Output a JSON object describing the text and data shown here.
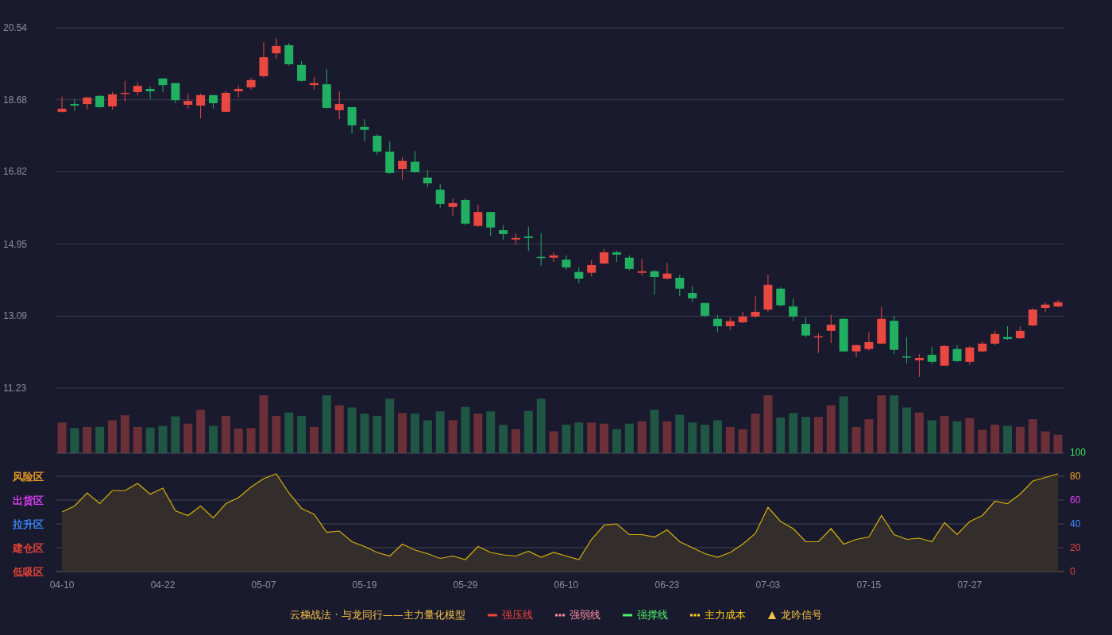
{
  "price_chart": {
    "chart_data": {
      "type": "candlestick",
      "grid": true,
      "ylim": [
        11.23,
        20.54
      ],
      "yticks": [
        20.54,
        18.68,
        16.82,
        14.95,
        13.09,
        11.23
      ],
      "categories": [
        null,
        null,
        null,
        null,
        null,
        null,
        null,
        null,
        null,
        null,
        null,
        null,
        null,
        null,
        null,
        null,
        null,
        null,
        null,
        null,
        null,
        null,
        null,
        null,
        null,
        null,
        null,
        null,
        null,
        null,
        null,
        null,
        null,
        null,
        null,
        null,
        null,
        null,
        null,
        null,
        null,
        null,
        null,
        null,
        null,
        null,
        null,
        null,
        null,
        null,
        null,
        null,
        null,
        null,
        null,
        null,
        null,
        null,
        null,
        null,
        null,
        null,
        null,
        null,
        null,
        null,
        null,
        null,
        null,
        null,
        null,
        null,
        null,
        null,
        null,
        null,
        null,
        null,
        null,
        null
      ],
      "ohlc": [
        [
          18.37,
          18.76,
          18.35,
          18.45
        ],
        [
          18.57,
          18.7,
          18.39,
          18.53
        ],
        [
          18.57,
          18.76,
          18.43,
          18.74
        ],
        [
          18.78,
          18.8,
          18.47,
          18.49
        ],
        [
          18.51,
          18.88,
          18.43,
          18.82
        ],
        [
          18.84,
          19.17,
          18.63,
          18.86
        ],
        [
          18.88,
          19.13,
          18.8,
          19.04
        ],
        [
          18.96,
          19.02,
          18.7,
          18.9
        ],
        [
          19.23,
          19.23,
          18.88,
          19.06
        ],
        [
          19.11,
          19.11,
          18.59,
          18.67
        ],
        [
          18.55,
          18.84,
          18.45,
          18.65
        ],
        [
          18.53,
          18.84,
          18.2,
          18.8
        ],
        [
          18.8,
          18.8,
          18.45,
          18.59
        ],
        [
          18.37,
          18.9,
          18.37,
          18.86
        ],
        [
          18.9,
          19.04,
          18.74,
          18.96
        ],
        [
          19.0,
          19.25,
          18.94,
          19.19
        ],
        [
          19.29,
          20.17,
          19.25,
          19.78
        ],
        [
          19.88,
          20.27,
          19.74,
          20.07
        ],
        [
          20.09,
          20.15,
          19.56,
          19.6
        ],
        [
          19.58,
          19.68,
          19.15,
          19.17
        ],
        [
          19.06,
          19.27,
          18.94,
          19.11
        ],
        [
          19.08,
          19.47,
          18.45,
          18.47
        ],
        [
          18.41,
          18.9,
          18.18,
          18.57
        ],
        [
          18.49,
          18.49,
          17.81,
          18.02
        ],
        [
          17.98,
          18.18,
          17.61,
          17.9
        ],
        [
          17.75,
          17.79,
          17.26,
          17.34
        ],
        [
          17.34,
          17.61,
          16.77,
          16.79
        ],
        [
          16.89,
          17.2,
          16.62,
          17.1
        ],
        [
          17.08,
          17.36,
          16.79,
          16.81
        ],
        [
          16.67,
          16.87,
          16.42,
          16.52
        ],
        [
          16.36,
          16.5,
          15.89,
          15.99
        ],
        [
          15.91,
          16.13,
          15.68,
          16.01
        ],
        [
          16.09,
          16.13,
          15.44,
          15.48
        ],
        [
          15.42,
          15.97,
          15.4,
          15.78
        ],
        [
          15.78,
          15.78,
          15.17,
          15.38
        ],
        [
          15.31,
          15.44,
          15.07,
          15.21
        ],
        [
          15.07,
          15.23,
          14.94,
          15.11
        ],
        [
          15.15,
          15.4,
          14.78,
          15.11
        ],
        [
          14.62,
          15.23,
          14.39,
          14.6
        ],
        [
          14.6,
          14.74,
          14.49,
          14.66
        ],
        [
          14.55,
          14.66,
          14.29,
          14.35
        ],
        [
          14.23,
          14.35,
          13.94,
          14.06
        ],
        [
          14.21,
          14.53,
          14.12,
          14.41
        ],
        [
          14.45,
          14.82,
          14.43,
          14.74
        ],
        [
          14.74,
          14.78,
          14.49,
          14.68
        ],
        [
          14.6,
          14.66,
          14.27,
          14.31
        ],
        [
          14.21,
          14.57,
          14.14,
          14.25
        ],
        [
          14.25,
          14.29,
          13.65,
          14.1
        ],
        [
          14.06,
          14.47,
          14.04,
          14.19
        ],
        [
          14.08,
          14.16,
          13.61,
          13.8
        ],
        [
          13.69,
          13.86,
          13.45,
          13.55
        ],
        [
          13.43,
          13.43,
          13.06,
          13.1
        ],
        [
          13.02,
          13.12,
          12.67,
          12.83
        ],
        [
          12.83,
          13.06,
          12.73,
          12.96
        ],
        [
          12.93,
          13.2,
          12.91,
          13.08
        ],
        [
          13.08,
          13.61,
          13.04,
          13.2
        ],
        [
          13.26,
          14.16,
          13.2,
          13.9
        ],
        [
          13.8,
          13.84,
          13.34,
          13.37
        ],
        [
          13.34,
          13.55,
          12.97,
          13.08
        ],
        [
          12.89,
          13.06,
          12.55,
          12.59
        ],
        [
          12.55,
          12.65,
          12.14,
          12.57
        ],
        [
          12.71,
          13.12,
          12.4,
          12.87
        ],
        [
          13.02,
          13.04,
          12.16,
          12.18
        ],
        [
          12.18,
          12.36,
          12.03,
          12.34
        ],
        [
          12.24,
          12.67,
          12.2,
          12.42
        ],
        [
          12.38,
          13.34,
          12.36,
          13.02
        ],
        [
          12.97,
          13.1,
          12.11,
          12.22
        ],
        [
          12.05,
          12.55,
          11.87,
          12.03
        ],
        [
          11.95,
          12.11,
          11.52,
          12.01
        ],
        [
          12.09,
          12.3,
          11.85,
          11.91
        ],
        [
          11.81,
          12.34,
          11.81,
          12.32
        ],
        [
          12.24,
          12.34,
          11.91,
          11.93
        ],
        [
          11.91,
          12.32,
          11.83,
          12.28
        ],
        [
          12.18,
          12.44,
          12.16,
          12.38
        ],
        [
          12.38,
          12.71,
          12.34,
          12.63
        ],
        [
          12.55,
          12.83,
          12.48,
          12.5
        ],
        [
          12.52,
          12.83,
          12.5,
          12.71
        ],
        [
          12.85,
          13.3,
          12.83,
          13.26
        ],
        [
          13.3,
          13.45,
          13.2,
          13.39
        ],
        [
          13.34,
          13.51,
          13.32,
          13.45
        ]
      ]
    }
  },
  "indicator_chart": {
    "zones": [
      {
        "label": "风险区",
        "color": "#f5a623"
      },
      {
        "label": "出货区",
        "color": "#e040fb"
      },
      {
        "label": "拉升区",
        "color": "#3d8bfd"
      },
      {
        "label": "建仓区",
        "color": "#f0453a"
      },
      {
        "label": "低吸区",
        "color": "#f0453a"
      }
    ],
    "chart_data": {
      "type": "area",
      "grid": true,
      "ylim": [
        0,
        100
      ],
      "yticks": [
        100,
        80,
        60,
        40,
        20,
        0
      ],
      "categories": [
        "04-10",
        null,
        null,
        null,
        null,
        null,
        null,
        null,
        "04-22",
        null,
        null,
        null,
        null,
        null,
        null,
        null,
        "05-07",
        null,
        null,
        null,
        null,
        null,
        null,
        null,
        "05-19",
        null,
        null,
        null,
        null,
        null,
        null,
        null,
        "05-29",
        null,
        null,
        null,
        null,
        null,
        null,
        null,
        "06-10",
        null,
        null,
        null,
        null,
        null,
        null,
        null,
        "06-23",
        null,
        null,
        null,
        null,
        null,
        null,
        null,
        "07-03",
        null,
        null,
        null,
        null,
        null,
        null,
        null,
        "07-15",
        null,
        null,
        null,
        null,
        null,
        null,
        null,
        "07-27",
        null,
        null,
        null,
        null,
        null,
        null,
        null
      ],
      "series": [
        {
          "color": "#d4b20a",
          "values": [
            50,
            55,
            66,
            57,
            68,
            68,
            74,
            65,
            70,
            51,
            47,
            55,
            45,
            57,
            62,
            71,
            78,
            82,
            66,
            53,
            48,
            33,
            34,
            25,
            21,
            16,
            13,
            23,
            18,
            15,
            11,
            13,
            10,
            21,
            16,
            14,
            13,
            17,
            12,
            16,
            13,
            10,
            27,
            39,
            40,
            31,
            31,
            29,
            35,
            25,
            20,
            15,
            12,
            16,
            23,
            32,
            54,
            42,
            36,
            25,
            25,
            36,
            23,
            27,
            29,
            47,
            31,
            27,
            28,
            25,
            41,
            31,
            42,
            47,
            59,
            57,
            65,
            76,
            79,
            82
          ]
        }
      ]
    }
  },
  "legend": {
    "title": "云梯战法 · 与龙同行——主力量化模型",
    "items": [
      {
        "kind": "solid",
        "label": "强压线",
        "color": "#f0453a"
      },
      {
        "kind": "dashed",
        "label": "强弱线",
        "color": "#ff8fa3"
      },
      {
        "kind": "solid",
        "label": "强撑线",
        "color": "#4cf06a"
      },
      {
        "kind": "dashed",
        "label": "主力成本",
        "color": "#ffd21f"
      },
      {
        "kind": "triangle",
        "label": "龙吟信号",
        "color": "#f5c242"
      }
    ]
  }
}
